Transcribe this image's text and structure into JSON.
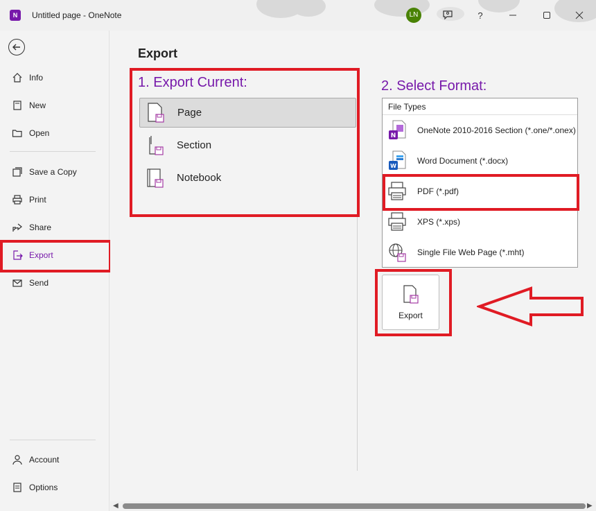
{
  "window": {
    "title": "Untitled page  -  OneNote",
    "app_logo": "N",
    "avatar_initials": "LN",
    "buttons": [
      "feedback-icon",
      "help-icon",
      "minimize-icon",
      "maximize-icon",
      "close-icon"
    ],
    "help_label": "?"
  },
  "sidebar": {
    "back_icon": "back-arrow-icon",
    "items": [
      {
        "label": "Info",
        "icon": "info-home-icon"
      },
      {
        "label": "New",
        "icon": "new-page-icon"
      },
      {
        "label": "Open",
        "icon": "folder-open-icon"
      },
      {
        "label": "Save a Copy",
        "icon": "save-copy-icon"
      },
      {
        "label": "Print",
        "icon": "printer-icon"
      },
      {
        "label": "Share",
        "icon": "share-icon"
      },
      {
        "label": "Export",
        "icon": "export-icon",
        "active": true
      },
      {
        "label": "Send",
        "icon": "send-icon"
      }
    ],
    "bottom_items": [
      {
        "label": "Account",
        "icon": "account-icon"
      },
      {
        "label": "Options",
        "icon": "options-icon"
      }
    ]
  },
  "main": {
    "title": "Export",
    "export_current": {
      "heading": "1. Export Current:",
      "options": [
        {
          "label": "Page",
          "selected": true
        },
        {
          "label": "Section",
          "selected": false
        },
        {
          "label": "Notebook",
          "selected": false
        }
      ]
    },
    "select_format": {
      "heading": "2. Select Format:",
      "header": "File Types",
      "types": [
        {
          "label": "OneNote 2010-2016 Section (*.one/*.onex)",
          "icon": "onenote-file-icon"
        },
        {
          "label": "Word Document (*.docx)",
          "icon": "word-file-icon"
        },
        {
          "label": "PDF (*.pdf)",
          "icon": "pdf-printer-icon"
        },
        {
          "label": "XPS (*.xps)",
          "icon": "xps-printer-icon"
        },
        {
          "label": "Single File Web Page (*.mht)",
          "icon": "web-page-file-icon"
        }
      ]
    },
    "export_button": "Export"
  },
  "colors": {
    "accent": "#7719aa",
    "annotation_red": "#e01b24",
    "avatar_bg": "#498205"
  }
}
